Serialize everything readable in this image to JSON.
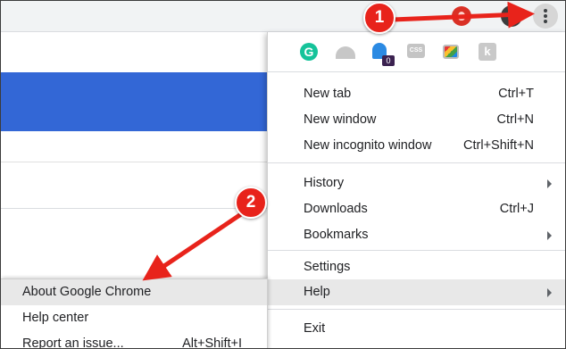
{
  "browser": {
    "extension_icons": [
      "red-extension-icon",
      "profile-avatar",
      "kebab-menu-icon"
    ]
  },
  "menu": {
    "extensions": {
      "ghost_badge": "0",
      "css_label": "CSS",
      "icons": [
        "grammarly-icon",
        "arc-icon",
        "ghostery-icon",
        "css-icon",
        "rainbow-icon",
        "k-icon"
      ]
    },
    "items": [
      {
        "label": "New tab",
        "shortcut": "Ctrl+T"
      },
      {
        "label": "New window",
        "shortcut": "Ctrl+N"
      },
      {
        "label": "New incognito window",
        "shortcut": "Ctrl+Shift+N"
      },
      {
        "label": "History",
        "shortcut": ""
      },
      {
        "label": "Downloads",
        "shortcut": "Ctrl+J"
      },
      {
        "label": "Bookmarks",
        "shortcut": ""
      },
      {
        "label": "Settings",
        "shortcut": ""
      },
      {
        "label": "Help",
        "shortcut": ""
      },
      {
        "label": "Exit",
        "shortcut": ""
      }
    ]
  },
  "help_submenu": {
    "items": [
      {
        "label": "About Google Chrome",
        "shortcut": ""
      },
      {
        "label": "Help center",
        "shortcut": ""
      },
      {
        "label": "Report an issue...",
        "shortcut": "Alt+Shift+I"
      }
    ]
  },
  "annotations": {
    "step1": "1",
    "step2": "2",
    "color": "#e8231b"
  },
  "colors": {
    "page_banner": "#3367d6",
    "menu_highlight": "#e8e8e8",
    "grammarly": "#15c39a",
    "ghostery": "#2b8ae3"
  }
}
